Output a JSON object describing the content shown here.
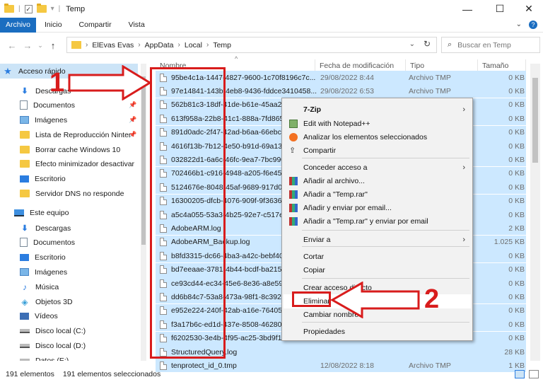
{
  "window": {
    "title": "Temp",
    "controls": {
      "minimize": "—",
      "maximize": "☐",
      "close": "✕"
    },
    "qa_separator": "|",
    "qa_check": "✓",
    "qa_dropdown": "▾"
  },
  "ribbon": {
    "tabs": [
      "Archivo",
      "Inicio",
      "Compartir",
      "Vista"
    ],
    "expand": "⌄",
    "help": "?"
  },
  "address": {
    "back": "←",
    "forward": "→",
    "recent": "⌄",
    "up": "↑",
    "crumbs": [
      "ElEvas Evas",
      "AppData",
      "Local",
      "Temp"
    ],
    "separator": "›",
    "dropdown": "⌄",
    "refresh": "↻"
  },
  "search": {
    "icon": "⌕",
    "placeholder": "Buscar en Temp"
  },
  "nav": {
    "quick_access": "Acceso rápido",
    "pin": "📌",
    "items": [
      {
        "label": "Acceso rápido",
        "icon": "star-icon"
      },
      {
        "label": "Descargas",
        "icon": "download-icon"
      },
      {
        "label": "Documentos",
        "icon": "documents-icon"
      },
      {
        "label": "Imágenes",
        "icon": "pictures-icon"
      },
      {
        "label": "Lista de Reproducción Ninter",
        "icon": "folder-icon"
      },
      {
        "label": "Borrar cache Windows 10",
        "icon": "folder-icon"
      },
      {
        "label": "Efecto minimizador desactivar",
        "icon": "folder-icon"
      },
      {
        "label": "Escritorio",
        "icon": "desktop-icon"
      },
      {
        "label": "Servidor DNS no responde",
        "icon": "folder-icon"
      },
      {
        "label": "Este equipo",
        "icon": "computer-icon"
      },
      {
        "label": "Descargas",
        "icon": "download-icon"
      },
      {
        "label": "Documentos",
        "icon": "documents-icon"
      },
      {
        "label": "Escritorio",
        "icon": "desktop-icon"
      },
      {
        "label": "Imágenes",
        "icon": "pictures-icon"
      },
      {
        "label": "Música",
        "icon": "music-icon"
      },
      {
        "label": "Objetos 3D",
        "icon": "objects-3d-icon"
      },
      {
        "label": "Vídeos",
        "icon": "videos-icon"
      },
      {
        "label": "Disco local (C:)",
        "icon": "drive-icon"
      },
      {
        "label": "Disco local (D:)",
        "icon": "drive-icon"
      },
      {
        "label": "Datos (E:)",
        "icon": "drive-icon"
      }
    ]
  },
  "columns": {
    "name": "Nombre",
    "date": "Fecha de modificación",
    "type": "Tipo",
    "size": "Tamaño",
    "sort": "^"
  },
  "files": [
    {
      "name": "95be4c1a-1447-4827-9600-1c70f8196c7c...",
      "date": "29/08/2022 8:44",
      "type": "Archivo TMP",
      "size": "0 KB"
    },
    {
      "name": "97e14841-143b-4eb8-9436-fddce3410458...",
      "date": "29/08/2022 6:53",
      "type": "Archivo TMP",
      "size": "0 KB"
    },
    {
      "name": "562b81c3-18df-41de-b61e-45aa27",
      "date": "",
      "type": "",
      "size": "0 KB"
    },
    {
      "name": "613f958a-22b8-41c1-888a-7fd865",
      "date": "",
      "type": "",
      "size": "0 KB"
    },
    {
      "name": "891d0adc-2f47-42ad-b6aa-66ebca",
      "date": "",
      "type": "",
      "size": "0 KB"
    },
    {
      "name": "4616f13b-7b12-4e50-b91d-69a134",
      "date": "",
      "type": "",
      "size": "0 KB"
    },
    {
      "name": "032822d1-6a6c-46fc-9ea7-7bc990",
      "date": "",
      "type": "",
      "size": "0 KB"
    },
    {
      "name": "702466b1-c916-4948-a205-f6e451",
      "date": "",
      "type": "",
      "size": "0 KB"
    },
    {
      "name": "5124676e-8048-45af-9689-917d0c",
      "date": "",
      "type": "",
      "size": "0 KB"
    },
    {
      "name": "16300205-dfcb-4076-909f-9f3636",
      "date": "",
      "type": "",
      "size": "0 KB"
    },
    {
      "name": "a5c4a055-53a3-4b25-92e7-c517e8",
      "date": "",
      "type": "",
      "size": "0 KB"
    },
    {
      "name": "AdobeARM.log",
      "date": "",
      "type": "",
      "size": "2 KB"
    },
    {
      "name": "AdobeARM_Backup.log",
      "date": "",
      "type": "",
      "size": "1.025 KB"
    },
    {
      "name": "b8fd3315-dc66-4ba3-a42c-bebf40",
      "date": "",
      "type": "",
      "size": "0 KB"
    },
    {
      "name": "bd7eeaae-3781-4b44-bcdf-ba2154",
      "date": "",
      "type": "",
      "size": "0 KB"
    },
    {
      "name": "ce93cd44-ec34-45e6-8e36-a8e590",
      "date": "",
      "type": "",
      "size": "0 KB"
    },
    {
      "name": "dd6b84c7-53a8-473a-98f1-8c3925",
      "date": "",
      "type": "",
      "size": "0 KB"
    },
    {
      "name": "e952e224-240f-42ab-a16e-76405a",
      "date": "",
      "type": "",
      "size": "0 KB"
    },
    {
      "name": "f3a17b6c-ed1d-437e-8508-462805",
      "date": "",
      "type": "",
      "size": "0 KB"
    },
    {
      "name": "f6202530-3e4b-4f95-ac25-3bd9f1",
      "date": "",
      "type": "",
      "size": "0 KB"
    },
    {
      "name": "StructuredQuery.log",
      "date": "",
      "type": "",
      "size": "28 KB"
    },
    {
      "name": "tenprotect_id_0.tmp",
      "date": "12/08/2022 8:18",
      "type": "Archivo TMP",
      "size": "1 KB"
    }
  ],
  "context_menu": {
    "items": [
      {
        "label": "7-Zip",
        "submenu": true,
        "icon": ""
      },
      {
        "label": "Edit with Notepad++",
        "submenu": false,
        "icon": "notepadpp-icon"
      },
      {
        "label": "Analizar los elementos seleccionados",
        "submenu": false,
        "icon": "avast-icon"
      },
      {
        "label": "Compartir",
        "submenu": false,
        "icon": "share-icon"
      },
      {
        "label": "Conceder acceso a",
        "submenu": true,
        "icon": ""
      },
      {
        "label": "Añadir al archivo...",
        "submenu": false,
        "icon": "winrar-icon"
      },
      {
        "label": "Añadir a \"Temp.rar\"",
        "submenu": false,
        "icon": "winrar-icon"
      },
      {
        "label": "Añadir y enviar por email...",
        "submenu": false,
        "icon": "winrar-icon"
      },
      {
        "label": "Añadir a \"Temp.rar\" y enviar por email",
        "submenu": false,
        "icon": "winrar-icon"
      },
      {
        "label": "Enviar a",
        "submenu": true,
        "icon": ""
      },
      {
        "label": "Cortar",
        "submenu": false,
        "icon": ""
      },
      {
        "label": "Copiar",
        "submenu": false,
        "icon": ""
      },
      {
        "label": "Crear acceso directo",
        "submenu": false,
        "icon": ""
      },
      {
        "label": "Eliminar",
        "submenu": false,
        "icon": ""
      },
      {
        "label": "Cambiar nombre",
        "submenu": false,
        "icon": ""
      },
      {
        "label": "Propiedades",
        "submenu": false,
        "icon": ""
      }
    ],
    "submenu_arrow": "›",
    "share_glyph": "⇪"
  },
  "annotations": {
    "step1": "1",
    "step2": "2",
    "color": "#d81c1c"
  },
  "status": {
    "count": "191 elementos",
    "selected": "191 elementos seleccionados"
  },
  "colors": {
    "selection": "#cce8ff",
    "nav_selected": "#cce4f7",
    "accent": "#1a6dc0",
    "annotation": "#d81c1c"
  }
}
